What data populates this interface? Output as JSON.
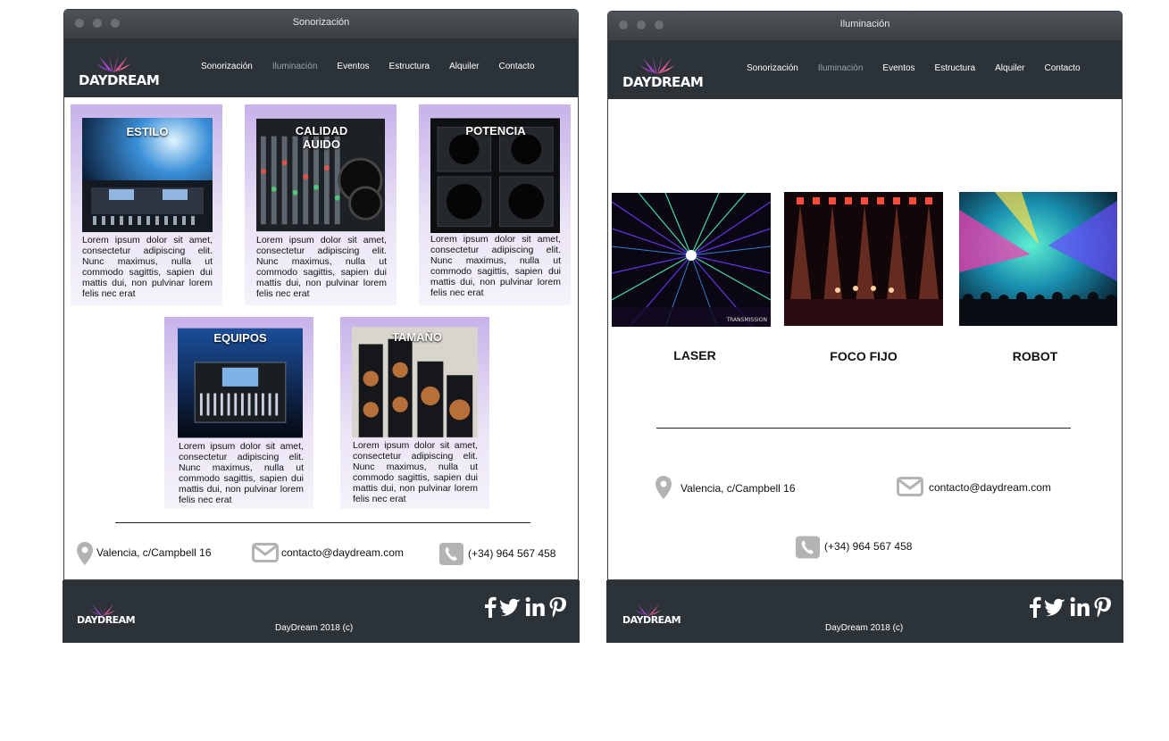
{
  "brand": {
    "name": "DAYDREAM"
  },
  "windows": [
    {
      "title": "Sonorización",
      "nav": [
        "Sonorización",
        "Iluminación",
        "Eventos",
        "Estructura",
        "Alquiler",
        "Contacto"
      ],
      "active_nav": "Iluminación",
      "features": [
        {
          "title": "ESTILO",
          "text": "Lorem ipsum dolor sit amet, consectetur adipiscing elit. Nunc maximus, nulla ut commodo sagittis, sapien dui mattis dui, non pulvinar lorem felis nec erat"
        },
        {
          "title_line1": "CALIDAD",
          "title_line2": "AUIDO",
          "text": "Lorem ipsum dolor sit amet, consectetur adipiscing elit. Nunc maximus, nulla ut commodo sagittis, sapien dui mattis dui, non pulvinar lorem felis nec erat"
        },
        {
          "title": "POTENCIA",
          "text": "Lorem ipsum dolor sit amet, consectetur adipiscing elit. Nunc maximus, nulla ut commodo sagittis, sapien dui mattis dui, non pulvinar lorem felis nec erat"
        },
        {
          "title": "EQUIPOS",
          "text": "Lorem ipsum dolor sit amet, consectetur adipiscing elit. Nunc maximus, nulla ut commodo sagittis, sapien dui mattis dui, non pulvinar lorem felis nec erat"
        },
        {
          "title": "TAMAÑO",
          "text": "Lorem ipsum dolor sit amet, consectetur adipiscing elit. Nunc maximus, nulla ut commodo sagittis, sapien dui mattis dui, non pulvinar lorem felis nec erat"
        }
      ],
      "contact": {
        "address": "Valencia, c/Campbell 16",
        "email": "contacto@daydream.com",
        "phone": "(+34) 964 567 458"
      },
      "footer": "DayDream 2018 (c)"
    },
    {
      "title": "Iluminación",
      "nav": [
        "Sonorización",
        "Iluminación",
        "Eventos",
        "Estructura",
        "Alquiler",
        "Contacto"
      ],
      "active_nav": "Iluminación",
      "lights": [
        {
          "label": "LASER",
          "watermark": "TRANSMISSION"
        },
        {
          "label": "FOCO FIJO"
        },
        {
          "label": "ROBOT"
        }
      ],
      "contact": {
        "address": "Valencia, c/Campbell 16",
        "email": "contacto@daydream.com",
        "phone": "(+34) 964 567 458"
      },
      "footer": "DayDream 2018 (c)"
    }
  ],
  "icons": [
    "map-pin-icon",
    "envelope-icon",
    "phone-icon",
    "facebook-icon",
    "twitter-icon",
    "linkedin-icon",
    "pinterest-icon"
  ],
  "colors": {
    "navbar": "#2b3238",
    "card_top": "#c7b2ea",
    "card_bottom": "#f6f3fb",
    "nav_active": "#9aa3ab"
  }
}
